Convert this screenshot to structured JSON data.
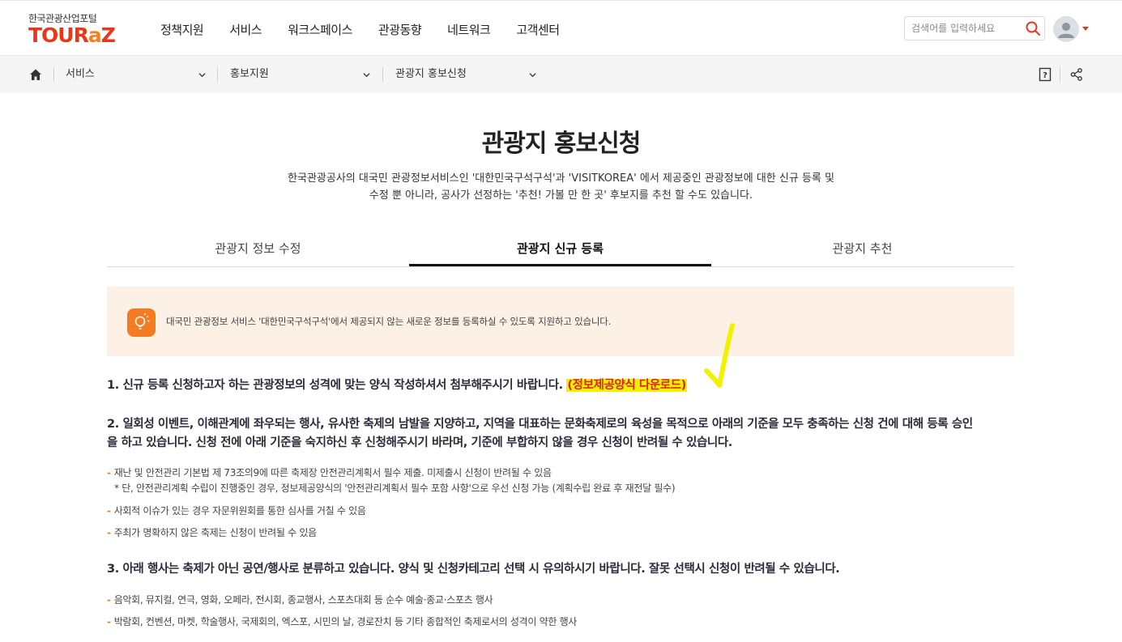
{
  "header": {
    "logo_sub": "한국관광산업포털",
    "logo_main_a": "TOUR",
    "logo_main_z": "a",
    "logo_main_b": "Z",
    "nav": [
      "정책지원",
      "서비스",
      "워크스페이스",
      "관광동향",
      "네트워크",
      "고객센터"
    ],
    "search_placeholder": "검색어를 입력하세요"
  },
  "breadcrumb": {
    "items": [
      "서비스",
      "홍보지원",
      "관광지 홍보신청"
    ]
  },
  "page": {
    "title": "관광지 홍보신청",
    "intro_line1": "한국관광공사의 대국민 관광정보서비스인 '대한민국구석구석'과 'VISITKOREA' 에서 제공중인 관광정보에 대한 신규 등록 및",
    "intro_line2": "수정 뿐 아니라, 공사가 선정하는 '추천! 가볼 만 한 곳' 후보지를 추천 할 수도 있습니다."
  },
  "tabs": [
    {
      "label": "관광지 정보 수정",
      "active": false
    },
    {
      "label": "관광지 신규 등록",
      "active": true
    },
    {
      "label": "관광지 추천",
      "active": false
    }
  ],
  "notice": {
    "text": "대국민 관광정보 서비스 '대한민국구석구석'에서 제공되지 않는 새로운 정보를 등록하실 수 있도록 지원하고 있습니다."
  },
  "content": {
    "p1_text": "1. 신규 등록 신청하고자 하는 관광정보의 성격에 맞는 양식 작성하셔서 첨부해주시기 바랍니다. ",
    "p1_link": "(정보제공양식 다운로드)",
    "p2_line1": "2. 일회성 이벤트, 이해관계에 좌우되는 행사, 유사한 축제의 남발을 지양하고, 지역을 대표하는 문화축제로의 육성을 목적으로 아래의 기준을 모두 충족하는 신청 건에 대해 등록 승인",
    "p2_line2": "을 하고 있습니다. 신청 전에 아래 기준을 숙지하신 후 신청해주시기 바라며, 기준에 부합하지 않을 경우 신청이 반려될 수 있습니다.",
    "p2_items": [
      "재난 및 안전관리 기본법 제 73조의9에 따른 축제장 안전관리계획서 필수 제출. 미제출시 신청이 반려될 수 있음",
      "* 단, 안전관리계획 수립이 진행중인 경우, 정보제공양식의 '안전관리계획서 필수 포함 사항'으로 우선 신청 가능 (계획수립 완료 후 재전달 필수)",
      "사회적 이슈가 있는 경우 자문위원회를 통한 심사를 거칠 수 있음",
      "주최가 명확하지 않은 축제는 신청이 반려될 수 있음"
    ],
    "p3_text": "3. 아래 행사는 축제가 아닌 공연/행사로 분류하고 있습니다. 양식 및 신청카테고리 선택 시 유의하시기 바랍니다. 잘못 선택시 신청이 반려될 수 있습니다.",
    "p3_items": [
      "음악회, 뮤지컬, 연극, 영화, 오페라, 전시회, 종교행사, 스포츠대회 등 순수 예술·종교·스포츠 행사",
      "박람회, 컨벤션, 마켓, 학술행사, 국제회의, 엑스포, 시민의 날, 경로잔치 등 기타 종합적인 축제로서의 성격이 약한 행사"
    ]
  },
  "colors": {
    "brand_red": "#e8381a",
    "brand_orange": "#f47b20",
    "notice_bg": "#fdf1e6",
    "highlight": "#f2f200"
  }
}
